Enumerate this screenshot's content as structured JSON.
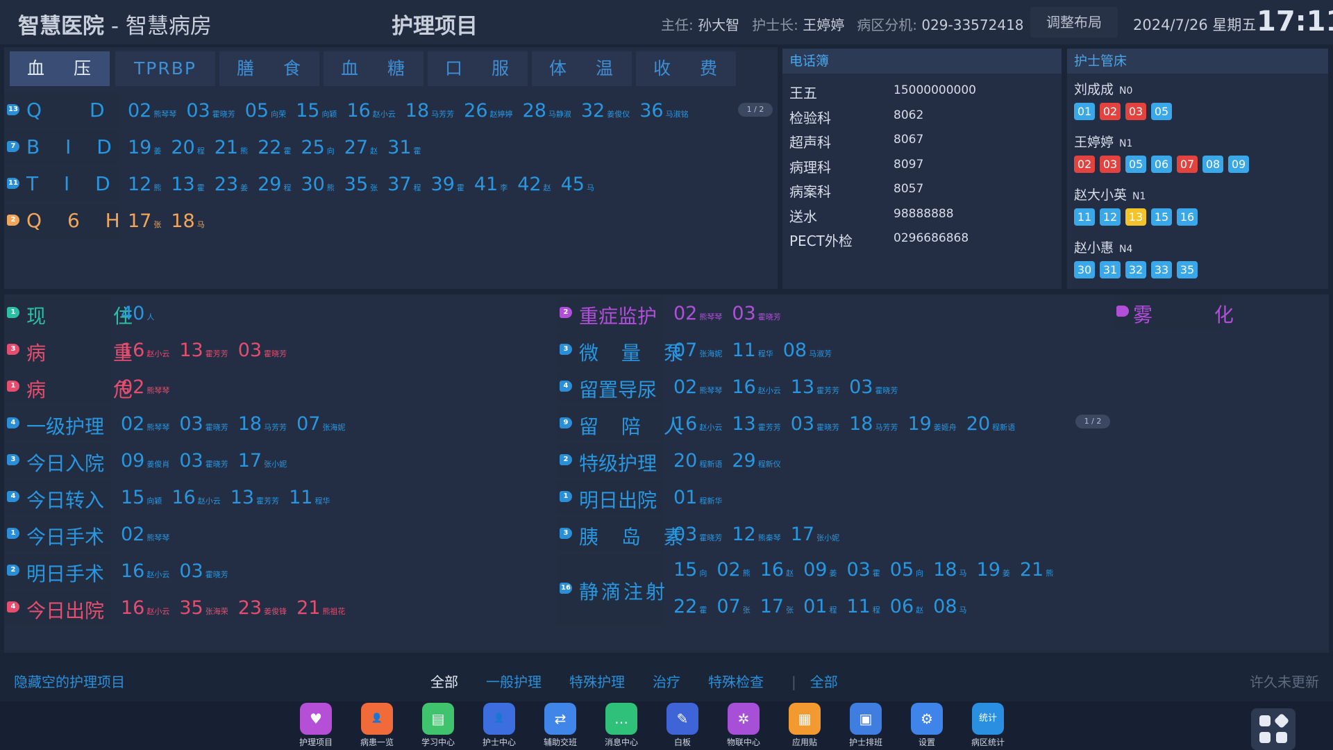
{
  "header": {
    "hospital": "智慧医院",
    "sep": " - ",
    "ward": "智慧病房",
    "center_title": "护理项目",
    "director_label": "主任:",
    "director": "孙大智",
    "head_nurse_label": "护士长:",
    "head_nurse": "王婷婷",
    "phone_label": "病区分机:",
    "phone": "029-33572418",
    "layout_button": "调整布局",
    "date": "2024/7/26 星期五",
    "time": "17:11"
  },
  "tabs": [
    {
      "a": "血",
      "b": "压"
    },
    {
      "a": "TPRBP",
      "b": ""
    },
    {
      "a": "膳",
      "b": "食"
    },
    {
      "a": "血",
      "b": "糖"
    },
    {
      "a": "口",
      "b": "服"
    },
    {
      "a": "体",
      "b": "温"
    },
    {
      "a": "收",
      "b": "费"
    }
  ],
  "bp_rows": [
    {
      "badge": "13",
      "label": "Q D",
      "color": "blue",
      "badge_color": "#2b8fd8",
      "items": [
        [
          "02",
          "熊琴琴"
        ],
        [
          "03",
          "霍晓芳"
        ],
        [
          "05",
          "向荣"
        ],
        [
          "15",
          "向颖"
        ],
        [
          "16",
          "赵小云"
        ],
        [
          "18",
          "马芳芳"
        ],
        [
          "26",
          "赵婷婷"
        ],
        [
          "28",
          "马静淑"
        ],
        [
          "32",
          "姜俊仪"
        ],
        [
          "36",
          "马淑铭"
        ]
      ]
    },
    {
      "badge": "7",
      "label": "B I D",
      "color": "blue",
      "badge_color": "#2b8fd8",
      "items": [
        [
          "19",
          "姜"
        ],
        [
          "20",
          "程"
        ],
        [
          "21",
          "熊"
        ],
        [
          "22",
          "霍"
        ],
        [
          "25",
          "向"
        ],
        [
          "27",
          "赵"
        ],
        [
          "31",
          "霍"
        ]
      ]
    },
    {
      "badge": "11",
      "label": "T I D",
      "color": "blue",
      "badge_color": "#2b8fd8",
      "items": [
        [
          "12",
          "熊"
        ],
        [
          "13",
          "霍"
        ],
        [
          "23",
          "姜"
        ],
        [
          "29",
          "程"
        ],
        [
          "30",
          "熊"
        ],
        [
          "35",
          "张"
        ],
        [
          "37",
          "程"
        ],
        [
          "39",
          "霍"
        ],
        [
          "41",
          "李"
        ],
        [
          "42",
          "赵"
        ],
        [
          "45",
          "马"
        ]
      ]
    },
    {
      "badge": "2",
      "label": "Q 6 H",
      "color": "orange",
      "badge_color": "#f2a65b",
      "items": [
        [
          "17",
          "张"
        ],
        [
          "18",
          "马"
        ]
      ]
    }
  ],
  "bp_pager": "1 / 2",
  "phonebook": {
    "title": "电话簿",
    "entries": [
      {
        "name": "王五",
        "number": "15000000000"
      },
      {
        "name": "检验科",
        "number": "8062"
      },
      {
        "name": "超声科",
        "number": "8067"
      },
      {
        "name": "病理科",
        "number": "8097"
      },
      {
        "name": "病案科",
        "number": "8057"
      },
      {
        "name": "送水",
        "number": "98888888"
      },
      {
        "name": "PECT外检",
        "number": "0296686868"
      }
    ]
  },
  "nurse_beds": {
    "title": "护士管床",
    "nurses": [
      {
        "name": "刘成成",
        "level": "N0",
        "beds": [
          [
            "01",
            "blue"
          ],
          [
            "02",
            "red"
          ],
          [
            "03",
            "red"
          ],
          [
            "05",
            "blue"
          ]
        ]
      },
      {
        "name": "王婷婷",
        "level": "N1",
        "beds": [
          [
            "02",
            "red"
          ],
          [
            "03",
            "red"
          ],
          [
            "05",
            "blue"
          ],
          [
            "06",
            "blue"
          ],
          [
            "07",
            "red"
          ],
          [
            "08",
            "blue"
          ],
          [
            "09",
            "blue"
          ]
        ]
      },
      {
        "name": "赵大小英",
        "level": "N1",
        "beds": [
          [
            "11",
            "blue"
          ],
          [
            "12",
            "blue"
          ],
          [
            "13",
            "yellow"
          ],
          [
            "15",
            "blue"
          ],
          [
            "16",
            "blue"
          ]
        ]
      },
      {
        "name": "赵小惠",
        "level": "N4",
        "beds": [
          [
            "30",
            "blue"
          ],
          [
            "31",
            "blue"
          ],
          [
            "32",
            "blue"
          ],
          [
            "33",
            "blue"
          ],
          [
            "35",
            "blue"
          ]
        ]
      }
    ]
  },
  "left_items": [
    {
      "badge": "1",
      "label": "现 住",
      "color": "teal",
      "badge_color": "#2bbfa4",
      "value_color": "blue",
      "items": [
        [
          "40",
          "人"
        ]
      ]
    },
    {
      "badge": "3",
      "label": "病 重",
      "color": "pink",
      "badge_color": "#e64d6e",
      "value_color": "pink",
      "items": [
        [
          "16",
          "赵小云"
        ],
        [
          "13",
          "霍芳芳"
        ],
        [
          "03",
          "霍晓芳"
        ]
      ]
    },
    {
      "badge": "1",
      "label": "病 危",
      "color": "pink",
      "badge_color": "#e64d6e",
      "value_color": "pink",
      "items": [
        [
          "02",
          "熊琴琴"
        ]
      ]
    },
    {
      "badge": "4",
      "label": "一级护理",
      "color": "blue",
      "badge_color": "#2b8fd8",
      "value_color": "blue",
      "items": [
        [
          "02",
          "熊琴琴"
        ],
        [
          "03",
          "霍晓芳"
        ],
        [
          "18",
          "马芳芳"
        ],
        [
          "07",
          "张海妮"
        ]
      ]
    },
    {
      "badge": "3",
      "label": "今日入院",
      "color": "blue",
      "badge_color": "#2b8fd8",
      "value_color": "blue",
      "items": [
        [
          "09",
          "姜俊肖"
        ],
        [
          "03",
          "霍晓芳"
        ],
        [
          "17",
          "张小妮"
        ]
      ]
    },
    {
      "badge": "4",
      "label": "今日转入",
      "color": "blue",
      "badge_color": "#2b8fd8",
      "value_color": "blue",
      "items": [
        [
          "15",
          "向颖"
        ],
        [
          "16",
          "赵小云"
        ],
        [
          "13",
          "霍芳芳"
        ],
        [
          "11",
          "程华"
        ]
      ]
    },
    {
      "badge": "1",
      "label": "今日手术",
      "color": "blue",
      "badge_color": "#2b8fd8",
      "value_color": "blue",
      "items": [
        [
          "02",
          "熊琴琴"
        ]
      ]
    },
    {
      "badge": "2",
      "label": "明日手术",
      "color": "blue",
      "badge_color": "#2b8fd8",
      "value_color": "blue",
      "items": [
        [
          "16",
          "赵小云"
        ],
        [
          "03",
          "霍晓芳"
        ]
      ]
    },
    {
      "badge": "4",
      "label": "今日出院",
      "color": "pink",
      "badge_color": "#e64d6e",
      "value_color": "pink",
      "items": [
        [
          "16",
          "赵小云"
        ],
        [
          "35",
          "张海荣"
        ],
        [
          "23",
          "姜俊锋"
        ],
        [
          "21",
          "熊祖花"
        ]
      ]
    }
  ],
  "right_items": [
    {
      "badge": "2",
      "label": "重症监护",
      "color": "purple",
      "badge_color": "#b14fd8",
      "value_color": "purple",
      "items": [
        [
          "02",
          "熊琴琴"
        ],
        [
          "03",
          "霍晓芳"
        ]
      ]
    },
    {
      "badge": "3",
      "label": "微 量 泵",
      "color": "blue",
      "badge_color": "#2b8fd8",
      "value_color": "blue",
      "items": [
        [
          "07",
          "张海妮"
        ],
        [
          "11",
          "程华"
        ],
        [
          "08",
          "马淑芳"
        ]
      ]
    },
    {
      "badge": "4",
      "label": "留置导尿",
      "color": "blue",
      "badge_color": "#2b8fd8",
      "value_color": "blue",
      "items": [
        [
          "02",
          "熊琴琴"
        ],
        [
          "16",
          "赵小云"
        ],
        [
          "13",
          "霍芳芳"
        ],
        [
          "03",
          "霍晓芳"
        ]
      ]
    },
    {
      "badge": "9",
      "label": "留 陪 人",
      "color": "blue",
      "badge_color": "#2b8fd8",
      "value_color": "blue",
      "items": [
        [
          "16",
          "赵小云"
        ],
        [
          "13",
          "霍芳芳"
        ],
        [
          "03",
          "霍晓芳"
        ],
        [
          "18",
          "马芳芳"
        ],
        [
          "19",
          "姜姬舟"
        ],
        [
          "20",
          "程新语"
        ]
      ]
    },
    {
      "badge": "2",
      "label": "特级护理",
      "color": "blue",
      "badge_color": "#2b8fd8",
      "value_color": "blue",
      "items": [
        [
          "20",
          "程新语"
        ],
        [
          "29",
          "程新仪"
        ]
      ]
    },
    {
      "badge": "1",
      "label": "明日出院",
      "color": "blue",
      "badge_color": "#2b8fd8",
      "value_color": "blue",
      "items": [
        [
          "01",
          "程新华"
        ]
      ]
    },
    {
      "badge": "3",
      "label": "胰 岛 素",
      "color": "blue",
      "badge_color": "#2b8fd8",
      "value_color": "blue",
      "items": [
        [
          "03",
          "霍晓芳"
        ],
        [
          "12",
          "熊秦琴"
        ],
        [
          "17",
          "张小妮"
        ]
      ]
    }
  ],
  "iv_row": {
    "badge": "16",
    "label": "静滴注射",
    "line1": [
      [
        "15",
        "向"
      ],
      [
        "02",
        "熊"
      ],
      [
        "16",
        "赵"
      ],
      [
        "09",
        "姜"
      ],
      [
        "03",
        "霍"
      ],
      [
        "05",
        "向"
      ],
      [
        "18",
        "马"
      ],
      [
        "19",
        "姜"
      ],
      [
        "21",
        "熊"
      ]
    ],
    "line2": [
      [
        "22",
        "霍"
      ],
      [
        "07",
        "张"
      ],
      [
        "17",
        "张"
      ],
      [
        "01",
        "程"
      ],
      [
        "11",
        "程"
      ],
      [
        "06",
        "赵"
      ],
      [
        "08",
        "马"
      ]
    ]
  },
  "nebulize": {
    "label": "雾 化"
  },
  "mid_pager": "1 / 2",
  "footer": {
    "hide_empty": "隐藏空的护理项目",
    "filters": [
      "全部",
      "一般护理",
      "特殊护理",
      "治疗",
      "特殊检查"
    ],
    "filter_all2": "全部",
    "status": "许久未更新"
  },
  "dock": [
    {
      "label": "护理项目",
      "color": "#b44fd6",
      "icon": "heart-monitor-icon",
      "glyph": "♥"
    },
    {
      "label": "病患一览",
      "color": "#f06a3a",
      "icon": "patient-icon",
      "glyph": "👤"
    },
    {
      "label": "学习中心",
      "color": "#3fc46d",
      "icon": "book-icon",
      "glyph": "▤"
    },
    {
      "label": "护士中心",
      "color": "#3d6ee0",
      "icon": "nurse-icon",
      "glyph": "👤"
    },
    {
      "label": "辅助交班",
      "color": "#3f86e8",
      "icon": "swap-icon",
      "glyph": "⇄"
    },
    {
      "label": "消息中心",
      "color": "#2fc079",
      "icon": "message-icon",
      "glyph": "…"
    },
    {
      "label": "白板",
      "color": "#3f64d8",
      "icon": "whiteboard-icon",
      "glyph": "✎"
    },
    {
      "label": "物联中心",
      "color": "#a74fd6",
      "icon": "iot-icon",
      "glyph": "✲"
    },
    {
      "label": "应用贴",
      "color": "#f29a30",
      "icon": "app-sticker-icon",
      "glyph": "▦"
    },
    {
      "label": "护士排班",
      "color": "#3f7ee0",
      "icon": "schedule-icon",
      "glyph": "▣"
    },
    {
      "label": "设置",
      "color": "#3f84e8",
      "icon": "gear-icon",
      "glyph": "⚙"
    },
    {
      "label": "病区统计",
      "color": "#2a8fe0",
      "icon": "stats-icon",
      "glyph": "统计"
    }
  ]
}
